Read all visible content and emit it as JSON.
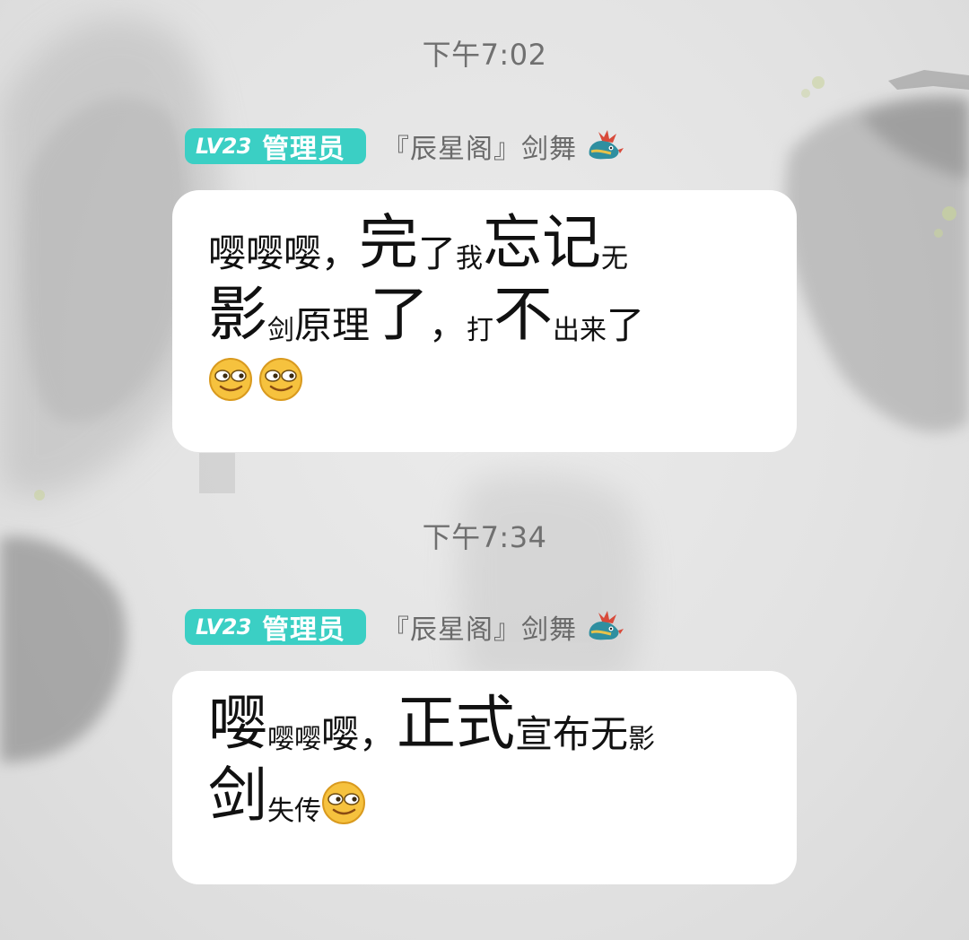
{
  "messages": [
    {
      "time": "下午7:02",
      "sender": {
        "level": "LV23",
        "role": "管理员",
        "name": "『辰星阁』剑舞"
      },
      "lines": [
        [
          {
            "text": "嘤嘤嘤，",
            "size": "m"
          },
          {
            "text": "完",
            "size": "xl"
          },
          {
            "text": "了",
            "size": "m"
          },
          {
            "text": "我",
            "size": "s"
          },
          {
            "text": "忘记",
            "size": "xl"
          },
          {
            "text": "无",
            "size": "s"
          }
        ],
        [
          {
            "text": "影",
            "size": "xl"
          },
          {
            "text": "剑",
            "size": "s"
          },
          {
            "text": "原理",
            "size": "m"
          },
          {
            "text": "了",
            "size": "xl"
          },
          {
            "text": "，",
            "size": "m"
          },
          {
            "text": "打",
            "size": "s"
          },
          {
            "text": "不",
            "size": "xl"
          },
          {
            "text": "出来",
            "size": "s"
          },
          {
            "text": "了",
            "size": "m"
          }
        ],
        [
          {
            "emoji": "smirk-emoji"
          },
          {
            "emoji": "smirk-emoji"
          }
        ]
      ]
    },
    {
      "time": "下午7:34",
      "sender": {
        "level": "LV23",
        "role": "管理员",
        "name": "『辰星阁』剑舞"
      },
      "lines": [
        [
          {
            "text": "嘤",
            "size": "xl"
          },
          {
            "text": "嘤嘤",
            "size": "s"
          },
          {
            "text": "嘤，",
            "size": "m"
          },
          {
            "text": "正式",
            "size": "xl"
          },
          {
            "text": "宣布无",
            "size": "m"
          },
          {
            "text": "影",
            "size": "s"
          }
        ],
        [
          {
            "text": "剑",
            "size": "xl"
          },
          {
            "text": "失传",
            "size": "s"
          },
          {
            "emoji": "smirk-emoji"
          }
        ]
      ]
    }
  ],
  "colors": {
    "badge": "#3bcfc4",
    "bubble": "#ffffff",
    "timestamp": "#707070",
    "sender": "#6a6a6a"
  }
}
